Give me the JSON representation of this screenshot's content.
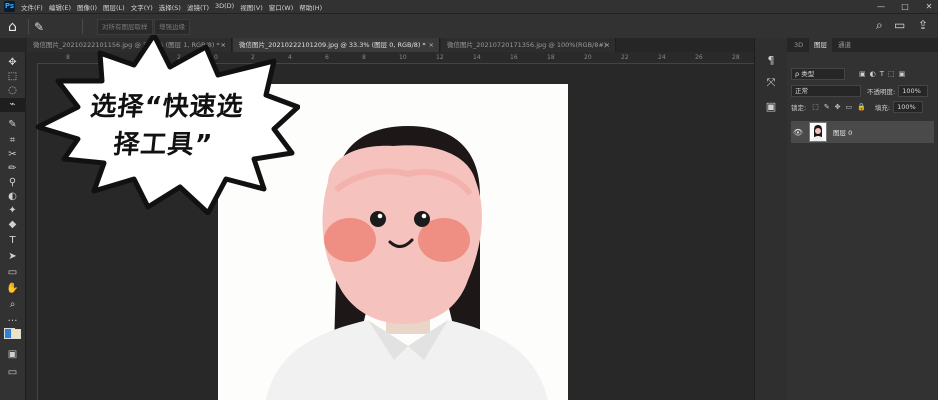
{
  "app": {
    "logo": "Ps"
  },
  "menu": [
    "文件(F)",
    "编辑(E)",
    "图像(I)",
    "图层(L)",
    "文字(Y)",
    "选择(S)",
    "滤镜(T)",
    "3D(D)",
    "视图(V)",
    "窗口(W)",
    "帮助(H)"
  ],
  "window_controls": {
    "minimize": "—",
    "maximize": "□",
    "close": "✕"
  },
  "options": {
    "home_icon": "⌂",
    "tool_icon": "✎",
    "btn_sample": "对所有图层取样",
    "btn_enhance": "增强边缘",
    "search_icon": "⌕",
    "workspace_icon": "▭",
    "share_icon": "⇪"
  },
  "tabs": [
    {
      "label": "微信图片_20210222101156.jpg @ 33.3% (图层 1, RGB/8) *",
      "close": "×"
    },
    {
      "label": "微信图片_20210222101209.jpg @ 33.3% (图层 0, RGB/8) *",
      "close": "×"
    },
    {
      "label": "微信图片_20210720171356.jpg @ 100%(RGB/8#)",
      "close": "×"
    }
  ],
  "ruler_ticks": [
    "8",
    "6",
    "4",
    "2",
    "0",
    "2",
    "4",
    "6",
    "8",
    "10",
    "12",
    "14",
    "16",
    "18",
    "20",
    "22",
    "24",
    "26",
    "28"
  ],
  "toolbar_tools": [
    "✥",
    "⬚",
    "◌",
    "⌁",
    "✎",
    "⌗",
    "✂",
    "✏",
    "⚲",
    "◐",
    "✦",
    "◆",
    "T",
    "➤",
    "▭",
    "✋",
    "⌕",
    "…",
    "◩",
    "▣",
    "▭"
  ],
  "canvas": {
    "bubble_line1": "选择“快速选",
    "bubble_line2": "择工具”"
  },
  "right_strip": [
    "¶",
    "⤧",
    "▣"
  ],
  "layers_panel": {
    "tab_3d": "3D",
    "tab_layers": "图层",
    "tab_channels": "通道",
    "kind_label": "ρ 类型",
    "blend_mode": "正常",
    "opacity_label": "不透明度:",
    "opacity_value": "100%",
    "lock_label": "锁定:",
    "fill_label": "填充:",
    "fill_value": "100%",
    "layer_name": "图层 0"
  }
}
